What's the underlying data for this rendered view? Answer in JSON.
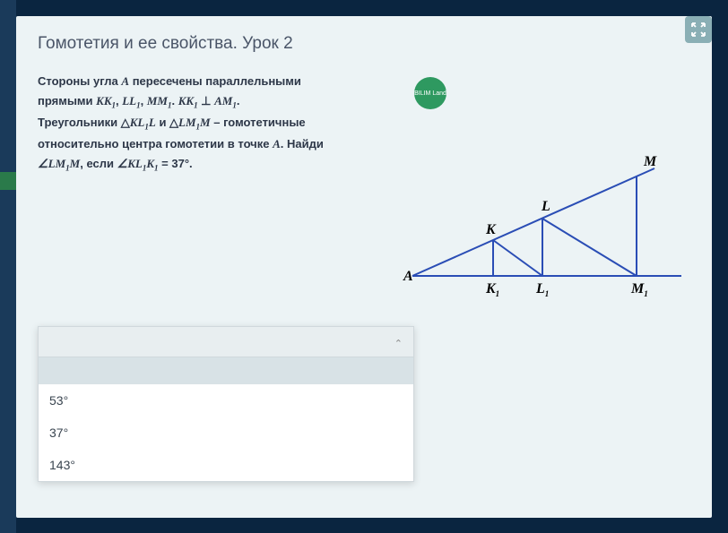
{
  "title": "Гомотетия и ее свойства. Урок 2",
  "problem": {
    "line1_a": "Стороны угла ",
    "line1_b": " пересечены параллельными",
    "line2_a": "прямыми ",
    "line3_a": "Треугольники ",
    "line3_b": " и ",
    "line3_c": " – гомотетичные",
    "line4": "относительно центра гомотетии в точке ",
    "line4_b": ". Найди",
    "line5_a": ", если ",
    "var_A": "A",
    "KK1": "KK",
    "LL1": "LL",
    "MM1": "MM",
    "AM1": "AM",
    "KL1L": "KL",
    "KL1L_b": "L",
    "LM1M": "LM",
    "LM1M_b": "M",
    "angle_LM1M": "∠LM",
    "angle_KL1K1": "∠KL",
    "KL1K1_b": "K",
    "eq": " = 37°.",
    "perp": " ⊥ ",
    "tri": " △",
    "sub1": "1",
    "dot": ". ",
    "comma": ", "
  },
  "badge": "BILIM Land",
  "figure_labels": {
    "A": "A",
    "K": "K",
    "L": "L",
    "M": "M",
    "K1": "K",
    "L1": "L",
    "M1": "M",
    "sub1": "1"
  },
  "dropdown": {
    "options": [
      "53°",
      "37°",
      "143°"
    ]
  }
}
